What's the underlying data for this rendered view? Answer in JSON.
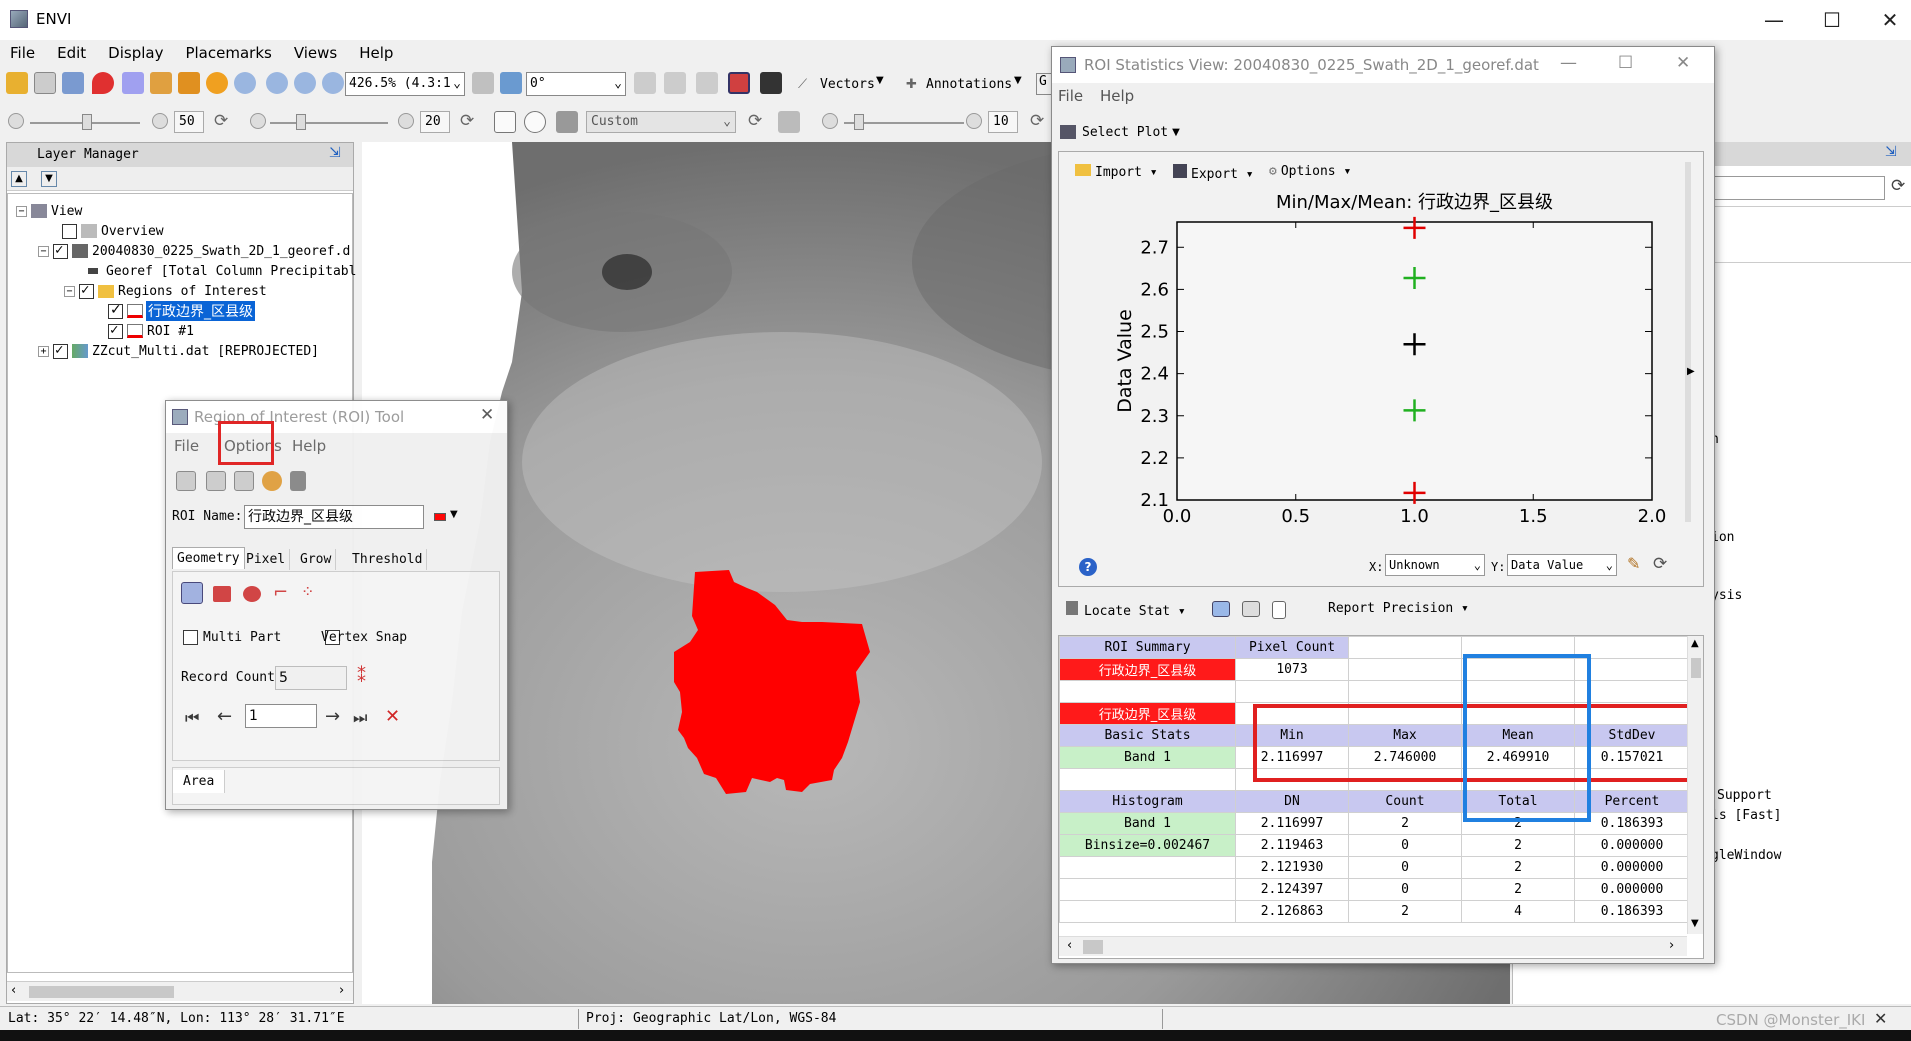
{
  "app": {
    "title": "ENVI"
  },
  "menubar": [
    "File",
    "Edit",
    "Display",
    "Placemarks",
    "Views",
    "Help"
  ],
  "toolbar": {
    "zoom_value": "426.5% (4.3:1",
    "rotation_value": "0°",
    "vectors_label": "Vectors",
    "annotations_label": "Annotations",
    "partial_label": "G",
    "brightness_value": "50",
    "contrast_value": "20",
    "stretch_value": "Custom",
    "sharpen_value": "10"
  },
  "layer_manager": {
    "title": "Layer Manager",
    "items": [
      "View",
      "Overview",
      "20040830_0225_Swath_2D_1_georef.d",
      "Georef [Total Column Precipitabl",
      "Regions of Interest",
      "行政边界_区县级",
      "ROI #1",
      "ZZcut_Multi.dat [REPROJECTED]"
    ]
  },
  "roi_tool": {
    "title": "Region of Interest (ROI) Tool",
    "menu": [
      "File",
      "Options",
      "Help"
    ],
    "name_label": "ROI Name:",
    "name_value": "行政边界_区县级",
    "tabs": [
      "Geometry",
      "Pixel",
      "Grow",
      "Threshold"
    ],
    "multi_part": "Multi Part",
    "vertex_snap": "Vertex Snap",
    "record_count_label": "Record Count",
    "record_count_value": "5",
    "nav_value": "1",
    "area_label": "Area"
  },
  "roi_stats": {
    "title": "ROI Statistics View: 20040830_0225_Swath_2D_1_georef.dat",
    "menu": [
      "File",
      "Help"
    ],
    "select_plot": "Select Plot",
    "plot_toolbar": [
      "Import",
      "Export",
      "Options"
    ],
    "x_label": "X:",
    "x_value": "Unknown",
    "y_label": "Y:",
    "y_value": "Data Value",
    "locate_stat": "Locate Stat",
    "report_precision": "Report Precision",
    "summary_header": [
      "ROI Summary",
      "Pixel Count"
    ],
    "summary_row": [
      "行政边界_区县级",
      "1073"
    ],
    "roi_name_row": "行政边界_区县级",
    "basic_header": [
      "Basic Stats",
      "Min",
      "Max",
      "Mean",
      "StdDev"
    ],
    "basic_row": [
      "Band 1",
      "2.116997",
      "2.746000",
      "2.469910",
      "0.157021"
    ],
    "hist_header": [
      "Histogram",
      "DN",
      "Count",
      "Total",
      "Percent"
    ],
    "hist_rows": [
      [
        "Band 1",
        "2.116997",
        "2",
        "2",
        "0.186393"
      ],
      [
        "Binsize=0.002467",
        "2.119463",
        "0",
        "2",
        "0.000000"
      ],
      [
        "",
        "2.121930",
        "0",
        "2",
        "0.000000"
      ],
      [
        "",
        "2.124397",
        "0",
        "2",
        "0.000000"
      ],
      [
        "",
        "2.126863",
        "2",
        "4",
        "0.186393"
      ]
    ]
  },
  "chart_data": {
    "type": "scatter",
    "title": "Min/Max/Mean: 行政边界_区县级",
    "xlabel": "Unknown",
    "ylabel": "Data Value",
    "xlim": [
      0.0,
      2.0
    ],
    "ylim": [
      2.1,
      2.76
    ],
    "x_ticks": [
      "0.0",
      "0.5",
      "1.0",
      "1.5",
      "2.0"
    ],
    "y_ticks": [
      "2.1",
      "2.2",
      "2.3",
      "2.4",
      "2.5",
      "2.6",
      "2.7"
    ],
    "points": [
      {
        "x": 1.0,
        "y": 2.116997,
        "color": "#e00000",
        "role": "min"
      },
      {
        "x": 1.0,
        "y": 2.746,
        "color": "#e00000",
        "role": "max"
      },
      {
        "x": 1.0,
        "y": 2.46991,
        "color": "#000000",
        "role": "mean"
      },
      {
        "x": 1.0,
        "y": 2.312889,
        "color": "#20b020",
        "role": "mean-stddev"
      },
      {
        "x": 1.0,
        "y": 2.626931,
        "color": "#20b020",
        "role": "mean+stddev"
      }
    ]
  },
  "right_panel": {
    "fragments": [
      "n",
      "ion",
      "ysis",
      "Support",
      "ls [Fast]",
      "gleWindow"
    ]
  },
  "status_bar": {
    "coords": "Lat: 35° 22′ 14.48″N, Lon: 113° 28′ 31.71″E",
    "proj": "Proj: Geographic Lat/Lon, WGS-84",
    "watermark": "CSDN @Monster_IKI"
  },
  "colors": {
    "roi_red": "#ff0000",
    "highlight_red": "#e02020",
    "highlight_blue": "#2080e0"
  }
}
